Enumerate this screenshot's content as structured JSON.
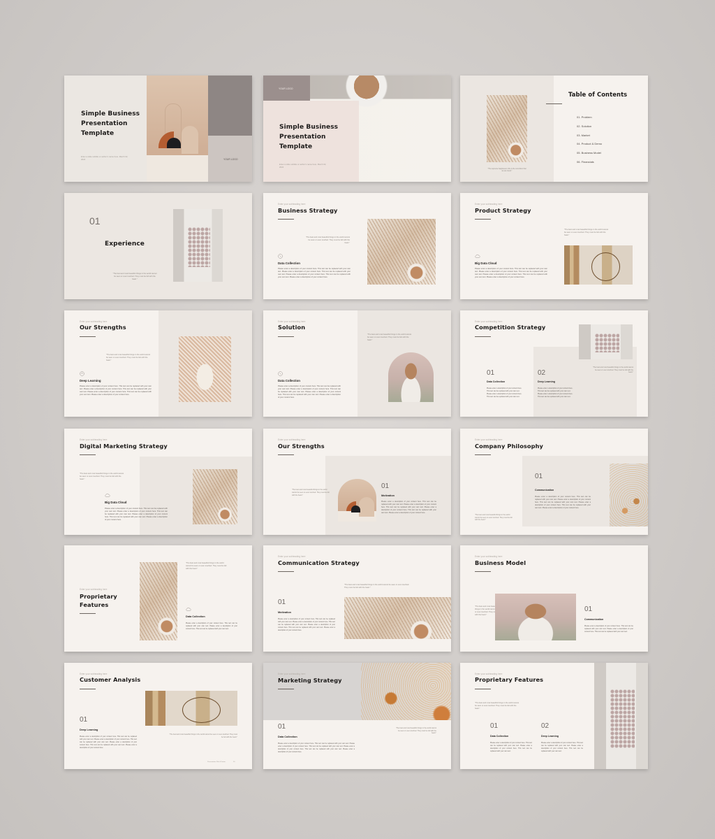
{
  "page": {
    "background": "#cdc9c6",
    "slide_background": "#f6f2ee",
    "panel_color": "#ebe6e1",
    "accent_dark": "#1d1b1a",
    "logo_block_color": "#8e8684"
  },
  "common": {
    "subheading": "Enter your subheading here",
    "quote": "\"The best and most beautiful things in the world cannot be seen or even touched. They must be felt with the heart.\"",
    "description": "Please enter a description of your content here. This text can be replaced with your own text. Please enter a description of your content here. This text can be replaced with your own text. Please enter a description of your content here. This text can be replaced with your own text. Please enter a description of your content here.",
    "description_short": "Please enter a description of your content here. This text can be replaced with your own text. Please enter a description of your content here. This text can be replaced with your own text."
  },
  "slides": [
    {
      "title": "Simple Business Presentation Template",
      "subtitle": "Enter a slide subtitle or author's name here. March 02, 2024",
      "logo": "YOUR LOGO"
    },
    {
      "title": "Simple Business Presentation Template",
      "subtitle": "Enter a slide subtitle or author's name here. March 02, 2024",
      "logo": "YOUR LOGO"
    },
    {
      "title": "Table of Contents",
      "caption": "\"The supreme happiness in life is the conviction that we are loved.\"",
      "items": [
        "01. Problem",
        "02. Solution",
        "03. Market",
        "04. Product & Demo",
        "05. Business Model",
        "06. Financials"
      ]
    },
    {
      "number": "01",
      "title": "Experience"
    },
    {
      "title": "Business Strategy",
      "feature": "Data Collection",
      "icon": "pencil-circle-icon"
    },
    {
      "title": "Product Strategy",
      "feature": "Big Data Cloud",
      "icon": "cloud-icon"
    },
    {
      "title": "Our Strengths",
      "feature": "Deep Learning",
      "icon": "brain-icon"
    },
    {
      "title": "Solution",
      "feature": "Data Collection",
      "icon": "pencil-circle-icon"
    },
    {
      "title": "Competition Strategy",
      "features": [
        {
          "number": "01",
          "label": "Data Collection"
        },
        {
          "number": "02",
          "label": "Deep Learning"
        }
      ]
    },
    {
      "title": "Digital Marketing Strategy",
      "feature": "Big Data Cloud",
      "icon": "cloud-icon"
    },
    {
      "title": "Our Strengths",
      "number": "01",
      "feature": "Motivation"
    },
    {
      "title": "Company Philosophy",
      "number": "01",
      "feature": "Communication"
    },
    {
      "title": "Proprietary Features",
      "feature": "Data Collection",
      "icon": "cloud-icon"
    },
    {
      "title": "Communication Strategy",
      "number": "01",
      "feature": "Motivation"
    },
    {
      "title": "Business Model",
      "number": "01",
      "feature": "Communication"
    },
    {
      "title": "Customer Analysis",
      "number": "01",
      "feature": "Deep Learning",
      "footer": "Presentation Title & Footer",
      "page_number": "20"
    },
    {
      "title": "Marketing Strategy",
      "number": "01",
      "feature": "Data Collection"
    },
    {
      "title": "Proprietary Features",
      "features": [
        {
          "number": "01",
          "label": "Data Collection"
        },
        {
          "number": "02",
          "label": "Deep Learning"
        }
      ]
    }
  ]
}
